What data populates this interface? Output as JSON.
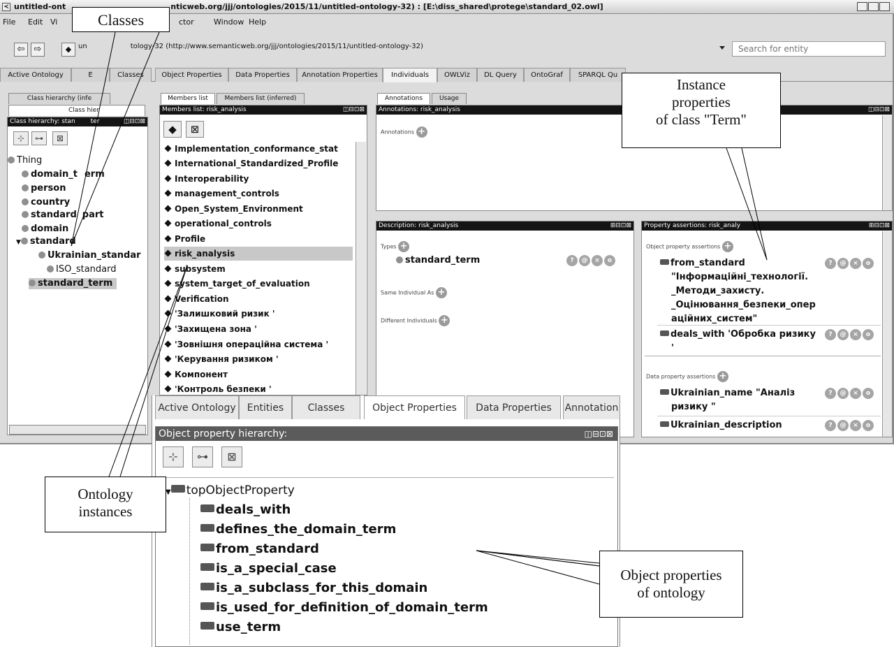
{
  "window": {
    "title": "untitled-ont",
    "title_rest": "nticweb.org/jjj/ontologies/2015/11/untitled-ontology-32) : [E:\\diss_shared\\protege\\standard_02.owl]"
  },
  "menu": [
    "File",
    "Edit",
    "Vi",
    "ctor",
    "Window",
    "Help"
  ],
  "address": {
    "ontology_prefix": "un",
    "ontology_text": "tology-32 (http://www.semanticweb.org/jjj/ontologies/2015/11/untitled-ontology-32)",
    "search_placeholder": "Search for entity"
  },
  "tabs": [
    "Active Ontology",
    "E",
    "Classes",
    "Object Properties",
    "Data Properties",
    "Annotation Properties",
    "Individuals",
    "OWLViz",
    "DL Query",
    "OntoGraf",
    "SPARQL Qu"
  ],
  "class_panel": {
    "tab1": "Class hierarchy (infe",
    "tab2": "Class hier",
    "header": "Class hierarchy: stan",
    "header_tail": "ter",
    "items": [
      "Thing",
      "domain_t",
      "erm",
      "person",
      "country",
      "standard",
      "part",
      "domain",
      "standard",
      "Ukrainian_standar",
      "ISO_standard",
      "standard_term"
    ]
  },
  "members": {
    "tab1": "Members list",
    "tab2": "Members list (inferred)",
    "header": "Members list: risk_analysis",
    "items": [
      "Implementation_conformance_stat",
      "International_Standardized_Profile",
      "Interoperability",
      "management_controls",
      "Open_System_Environment",
      "operational_controls",
      "Profile",
      "risk_analysis",
      "subsystem",
      "system_target_of_evaluation",
      "Verification",
      "'Залишковий ризик '",
      "'Захищена зона '",
      "'Зовнішня операційна система '",
      "'Керування ризиком '",
      "Компонент",
      "'Контроль безпеки '"
    ],
    "selected": 7
  },
  "annotations": {
    "tab1": "Annotations",
    "tab2": "Usage",
    "header": "Annotations: risk_analysis",
    "label": "Annotations"
  },
  "description": {
    "header": "Description: risk_analysis",
    "types": "Types",
    "type_value": "standard_term",
    "same": "Same Individual As",
    "different": "Different Individuals"
  },
  "assertions": {
    "header": "Property assertions: risk_analy",
    "obj_label": "Object property assertions",
    "row1_prop": "from_standard",
    "row1_l1": "\"Інформаційні_технології.",
    "row1_l2": "_Методи_захисту.",
    "row1_l3": "_Оцінювання_безпеки_опер",
    "row1_l4": "аційних_систем\"",
    "row2_prop": "deals_with",
    "row2_val": "'Обробка ризику",
    "row2_tail": "'",
    "data_label": "Data property assertions",
    "row3_prop": "Ukrainian_name",
    "row3_val": "\"Аналіз",
    "row3_l2": "ризику \"",
    "row4_prop": "Ukrainian_description"
  },
  "bottom": {
    "tabs": [
      "Active Ontology",
      "Entities",
      "Classes",
      "Object Properties",
      "Data Properties",
      "Annotation"
    ],
    "header": "Object property hierarchy:",
    "root": "topObjectProperty",
    "items": [
      "deals_with",
      "defines_the_domain_term",
      "from_standard",
      "is_a_special_case",
      "is_a_subclass_for_this_domain",
      "is_used_for_definition_of_domain_term",
      "use_term"
    ]
  },
  "callouts": {
    "classes": "Classes",
    "instance_l1": "Instance",
    "instance_l2": "properties",
    "instance_l3": "of class \"Term\"",
    "ont_l1": "Ontology",
    "ont_l2": "instances",
    "obj_l1": "Object properties",
    "obj_l2": "of ontology"
  }
}
